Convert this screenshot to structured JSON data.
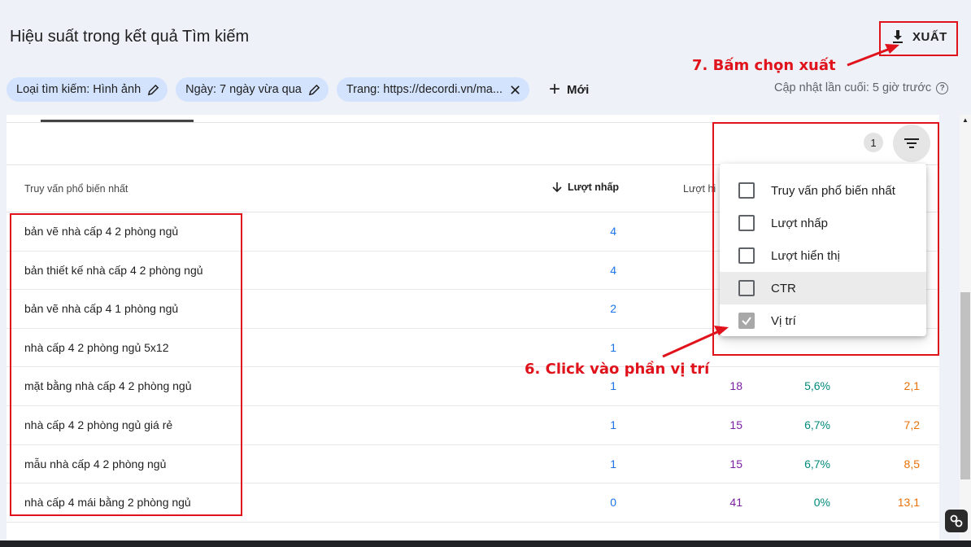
{
  "header": {
    "title": "Hiệu suất trong kết quả Tìm kiếm",
    "export_label": "XUẤT"
  },
  "filters": {
    "chips": [
      {
        "label": "Loại tìm kiếm: Hình ảnh",
        "icon": "pencil-icon"
      },
      {
        "label": "Ngày: 7 ngày vừa qua",
        "icon": "pencil-icon"
      },
      {
        "label": "Trang: https://decordi.vn/ma...",
        "icon": "close-icon"
      }
    ],
    "add_label": "Mới",
    "last_updated": "Cập nhật lần cuối: 5 giờ trước"
  },
  "table_toolbar": {
    "filter_count": "1"
  },
  "table": {
    "columns": {
      "query": "Truy vấn phổ biến nhất",
      "clicks": "Lượt nhấp",
      "impressions": "Lượt hi"
    },
    "rows": [
      {
        "query": "bản vẽ nhà cấp 4 2 phòng ngủ",
        "clicks": "4",
        "impressions": "",
        "ctr": "",
        "position": ""
      },
      {
        "query": "bản thiết kế nhà cấp 4 2 phòng ngủ",
        "clicks": "4",
        "impressions": "",
        "ctr": "",
        "position": ""
      },
      {
        "query": "bản vẽ nhà cấp 4 1 phòng ngủ",
        "clicks": "2",
        "impressions": "",
        "ctr": "",
        "position": ""
      },
      {
        "query": "nhà cấp 4 2 phòng ngủ 5x12",
        "clicks": "1",
        "impressions": "",
        "ctr": "",
        "position": ""
      },
      {
        "query": "mặt bằng nhà cấp 4 2 phòng ngủ",
        "clicks": "1",
        "impressions": "18",
        "ctr": "5,6%",
        "position": "2,1"
      },
      {
        "query": "nhà cấp 4 2 phòng ngủ giá rẻ",
        "clicks": "1",
        "impressions": "15",
        "ctr": "6,7%",
        "position": "7,2"
      },
      {
        "query": "mẫu nhà cấp 4 2 phòng ngủ",
        "clicks": "1",
        "impressions": "15",
        "ctr": "6,7%",
        "position": "8,5"
      },
      {
        "query": "nhà cấp 4 mái bằng 2 phòng ngủ",
        "clicks": "0",
        "impressions": "41",
        "ctr": "0%",
        "position": "13,1"
      }
    ]
  },
  "column_menu": {
    "items": [
      {
        "label": "Truy vấn phổ biến nhất",
        "checked": false
      },
      {
        "label": "Lượt nhấp",
        "checked": false
      },
      {
        "label": "Lượt hiển thị",
        "checked": false
      },
      {
        "label": "CTR",
        "checked": false
      },
      {
        "label": "Vị trí",
        "checked": true
      }
    ]
  },
  "annotations": {
    "step6": "6. Click vào phần vị trí",
    "step7": "7. Bấm chọn xuất"
  },
  "colors": {
    "clicks": "#1a73e8",
    "impressions": "#7b1fa2",
    "ctr": "#00897b",
    "position": "#e8710a",
    "annotation": "#e0121b",
    "chip_bg": "#d3e3fd"
  }
}
